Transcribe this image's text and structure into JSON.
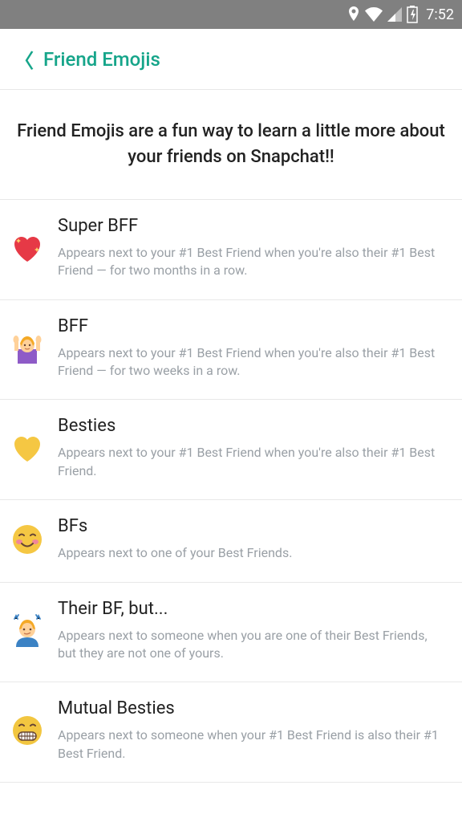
{
  "status_bar": {
    "time": "7:52"
  },
  "header": {
    "title": "Friend Emojis"
  },
  "intro": {
    "text": "Friend Emojis are a fun way to learn a little more about your friends on Snapchat!!"
  },
  "items": [
    {
      "icon": "heart-sparkle",
      "title": "Super BFF",
      "desc": "Appears next to your #1 Best Friend when you're also their #1 Best Friend — for two months in a row."
    },
    {
      "icon": "hands-up-woman",
      "title": "BFF",
      "desc": "Appears next to your #1 Best Friend when you're also their #1 Best Friend — for two weeks in a row."
    },
    {
      "icon": "yellow-heart",
      "title": "Besties",
      "desc": "Appears next to your #1 Best Friend when you're also their #1 Best Friend."
    },
    {
      "icon": "blush-face",
      "title": "BFs",
      "desc": "Appears next to one of your Best Friends."
    },
    {
      "icon": "smirk-person",
      "title": "Their BF, but...",
      "desc": "Appears next to someone when you are one of their Best Friends, but they are not one of yours."
    },
    {
      "icon": "grimace-face",
      "title": "Mutual Besties",
      "desc": "Appears next to someone when your #1 Best Friend is also their #1 Best Friend."
    }
  ]
}
